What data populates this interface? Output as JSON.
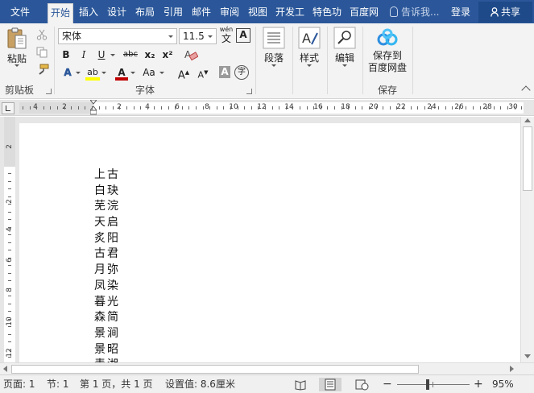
{
  "menu": {
    "tabs": [
      {
        "label": "文件",
        "active": false
      },
      {
        "label": "开始",
        "active": true
      },
      {
        "label": "插入",
        "active": false
      },
      {
        "label": "设计",
        "active": false
      },
      {
        "label": "布局",
        "active": false
      },
      {
        "label": "引用",
        "active": false
      },
      {
        "label": "邮件",
        "active": false
      },
      {
        "label": "审阅",
        "active": false
      },
      {
        "label": "视图",
        "active": false
      },
      {
        "label": "开发工",
        "active": false
      },
      {
        "label": "特色功",
        "active": false
      },
      {
        "label": "百度网",
        "active": false
      }
    ],
    "tell_me": "告诉我...",
    "login": "登录",
    "share": "共享"
  },
  "ribbon": {
    "clipboard": {
      "paste": "粘贴",
      "group": "剪贴板"
    },
    "font": {
      "name": "宋体",
      "size": "11.5",
      "wen": "wén",
      "wen_char": "文",
      "bold": "B",
      "italic": "I",
      "underline": "U",
      "strike": "abc",
      "subscript": "x₂",
      "superscript": "x²",
      "text_effect": "A",
      "highlight": "ab",
      "font_color": "A",
      "change_case": "Aa",
      "grow": "A",
      "shrink": "A",
      "char_shading": "A",
      "enclose": "字",
      "group": "字体"
    },
    "paragraph": {
      "label": "段落"
    },
    "styles": {
      "label": "样式"
    },
    "editing": {
      "label": "编辑"
    },
    "save": {
      "label1": "保存到",
      "label2": "百度网盘",
      "group": "保存"
    }
  },
  "ruler": {
    "h_ticks": [
      "4",
      "2",
      "2",
      "4",
      "6",
      "8",
      "10",
      "12",
      "14",
      "16",
      "18",
      "20",
      "22",
      "24",
      "26",
      "28",
      "30"
    ],
    "v_ticks": [
      "2",
      "2",
      "4",
      "6",
      "8",
      "10",
      "12"
    ]
  },
  "document": {
    "lines": [
      "上古",
      "白玦",
      "芜浣",
      "天启",
      "炙阳",
      "古君",
      "月弥",
      "凤染",
      "暮光",
      "森简",
      "景涧",
      "景昭",
      "青湘"
    ]
  },
  "status": {
    "page": "页面: 1",
    "section": "节: 1",
    "page_of": "第 1 页，共 1 页",
    "setting": "设置值: 8.6厘米",
    "zoom": "95%",
    "zoom_minus": "−",
    "zoom_plus": "+"
  },
  "colors": {
    "title_bar": "#2b579a",
    "ribbon_bg": "#f3f3f3",
    "highlight_yellow": "#ffff00",
    "font_red": "#c00000"
  }
}
